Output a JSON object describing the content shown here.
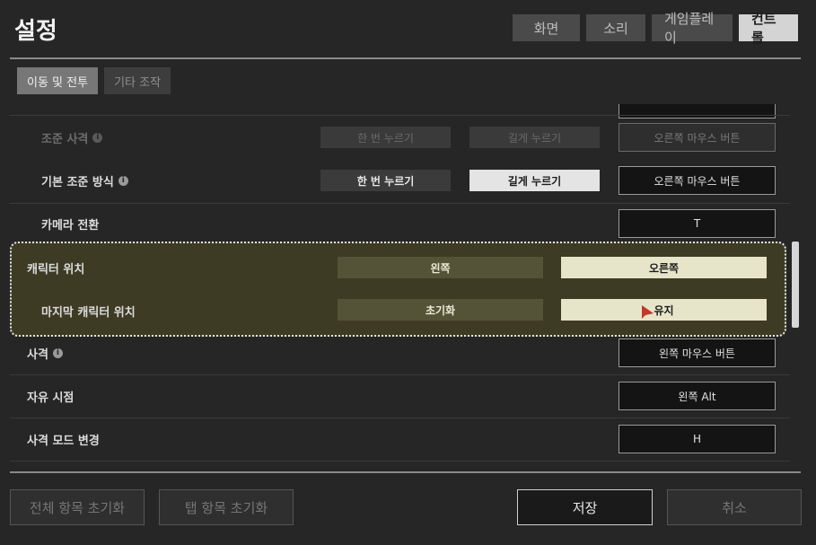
{
  "header": {
    "title": "설정"
  },
  "top_tabs": [
    {
      "label": "화면",
      "active": false
    },
    {
      "label": "소리",
      "active": false
    },
    {
      "label": "게임플레이",
      "active": false
    },
    {
      "label": "컨트롤",
      "active": true
    }
  ],
  "sub_tabs": [
    {
      "label": "이동 및 전투",
      "active": true
    },
    {
      "label": "기타 조작",
      "active": false
    }
  ],
  "rows": {
    "aim_shot": {
      "label": "조준 사격",
      "option_1": "한 번 누르기",
      "option_2": "길게 누르기",
      "key": "오른쪽 마우스 버튼",
      "disabled": true
    },
    "aim_mode": {
      "label": "기본 조준 방식",
      "option_1": "한 번 누르기",
      "option_2": "길게 누르기",
      "selected": "길게 누르기",
      "key": "오른쪽 마우스 버튼"
    },
    "camera_switch": {
      "label": "카메라 전환",
      "key": "T"
    },
    "character_position": {
      "label": "캐릭터 위치",
      "option_1": "왼쪽",
      "option_2": "오른쪽",
      "selected": "오른쪽"
    },
    "last_character_position": {
      "label": "마지막 캐릭터 위치",
      "option_1": "초기화",
      "option_2": "유지",
      "selected": "유지"
    },
    "fire": {
      "label": "사격",
      "key": "왼쪽 마우스 버튼"
    },
    "free_look": {
      "label": "자유 시점",
      "key": "왼쪽 Alt"
    },
    "fire_mode_change": {
      "label": "사격 모드 변경",
      "key": "H"
    }
  },
  "info_icon_glyph": "i",
  "footer": {
    "reset_all": "전체 항목 초기화",
    "reset_tab": "탭 항목 초기화",
    "save": "저장",
    "cancel": "취소"
  },
  "colors": {
    "highlight_bg": "#3e3b25",
    "selected_option": "#e7e5c9",
    "cursor": "#c0392b"
  }
}
